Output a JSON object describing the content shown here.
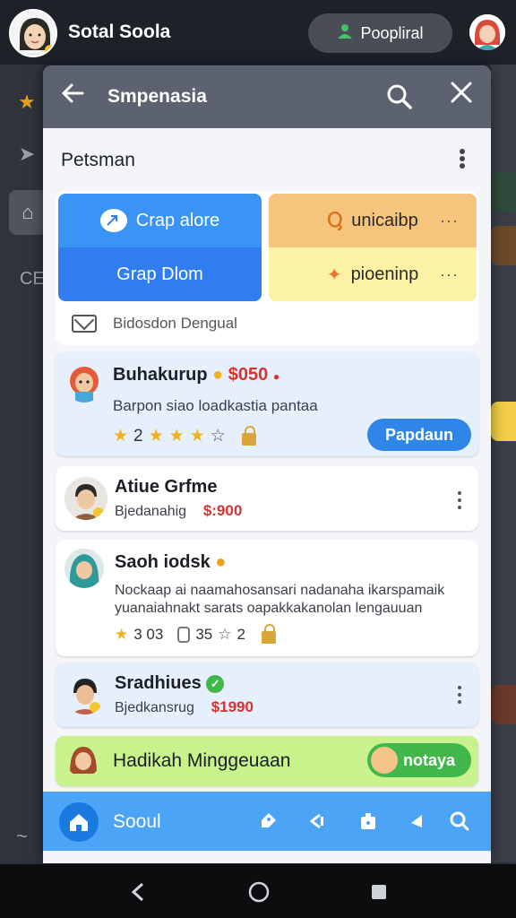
{
  "topbar": {
    "title": "Sotal Soola",
    "pill_label": "Poopliral"
  },
  "background": {
    "left_label": "CE"
  },
  "dialog": {
    "title": "Smpenasia",
    "section_label": "Petsman",
    "grid": {
      "btn1": "Crap alore",
      "btn2": "Grap Dlom",
      "btn3": "unicaibp",
      "btn4": "pioeninp",
      "footer_label": "Bidosdon Dengual"
    },
    "cards": [
      {
        "title": "Buhakurup",
        "price": "$050",
        "desc": "Barpon siao loadkastia pantaa",
        "rating": "2",
        "action_label": "Papdaun"
      },
      {
        "title": "Atiue Grfme",
        "sub": "Bjedanahig",
        "price": "$:900"
      },
      {
        "title": "Saoh iodsk",
        "desc_line1": "Nockaap ai naamahosansari nadanaha ikarspamaik",
        "desc_line2": "yuanaiahnakt sarats oapakkakanolan lengauuan",
        "rating": "3 03",
        "count": "35",
        "stars2": "2"
      },
      {
        "title": "Sradhiues",
        "sub": "Bjedkansrug",
        "price": "$1990"
      },
      {
        "title": "Hadikah Minggeuaan",
        "chip_label": "notaya"
      }
    ],
    "bottom_nav": {
      "label": "Sooul"
    }
  },
  "colors": {
    "accent_blue": "#2f86e8",
    "price_red": "#d3342f",
    "green": "#41b64a",
    "star_gold": "#f0b21e"
  }
}
